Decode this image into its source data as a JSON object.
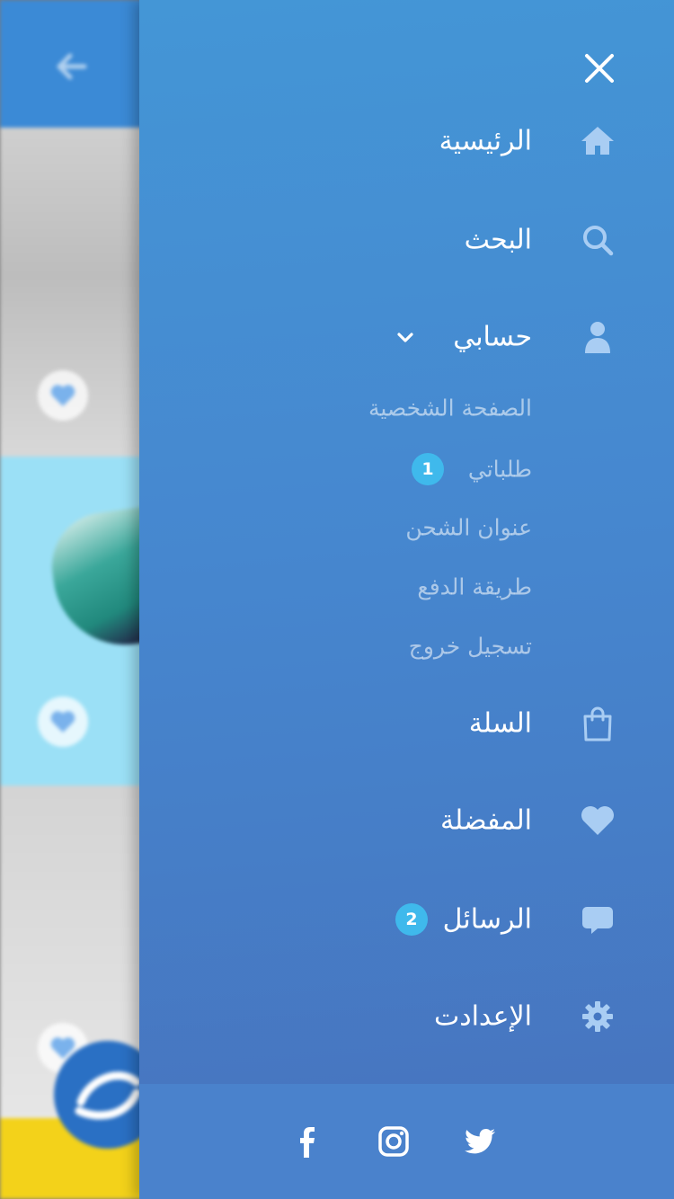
{
  "background": {
    "back_icon": "arrow-left-icon",
    "fab_icon": "app-logo-icon"
  },
  "drawer": {
    "close_icon": "close-icon",
    "menu": [
      {
        "label": "الرئيسية",
        "icon": "home-icon"
      },
      {
        "label": "البحث",
        "icon": "search-icon"
      },
      {
        "label": "حسابي",
        "icon": "user-icon",
        "expanded": true
      }
    ],
    "account_submenu": [
      {
        "label": "الصفحة الشخصية"
      },
      {
        "label": "طلباتي",
        "badge": "1"
      },
      {
        "label": "عنوان الشحن"
      },
      {
        "label": "طريقة الدفع"
      },
      {
        "label": "تسجيل خروج"
      }
    ],
    "menu_after": [
      {
        "label": "السلة",
        "icon": "shopping-bag-icon"
      },
      {
        "label": "المفضلة",
        "icon": "heart-icon"
      },
      {
        "label": "الرسائل",
        "icon": "chat-bubble-icon",
        "badge": "2"
      },
      {
        "label": "الإعدادت",
        "icon": "gear-icon"
      }
    ],
    "social": [
      "facebook-icon",
      "instagram-icon",
      "twitter-icon"
    ]
  },
  "colors": {
    "drawer_top": "#4496d6",
    "drawer_bottom": "#4772bd",
    "badge": "#3fb9ec",
    "footer": "#4a82cc"
  }
}
